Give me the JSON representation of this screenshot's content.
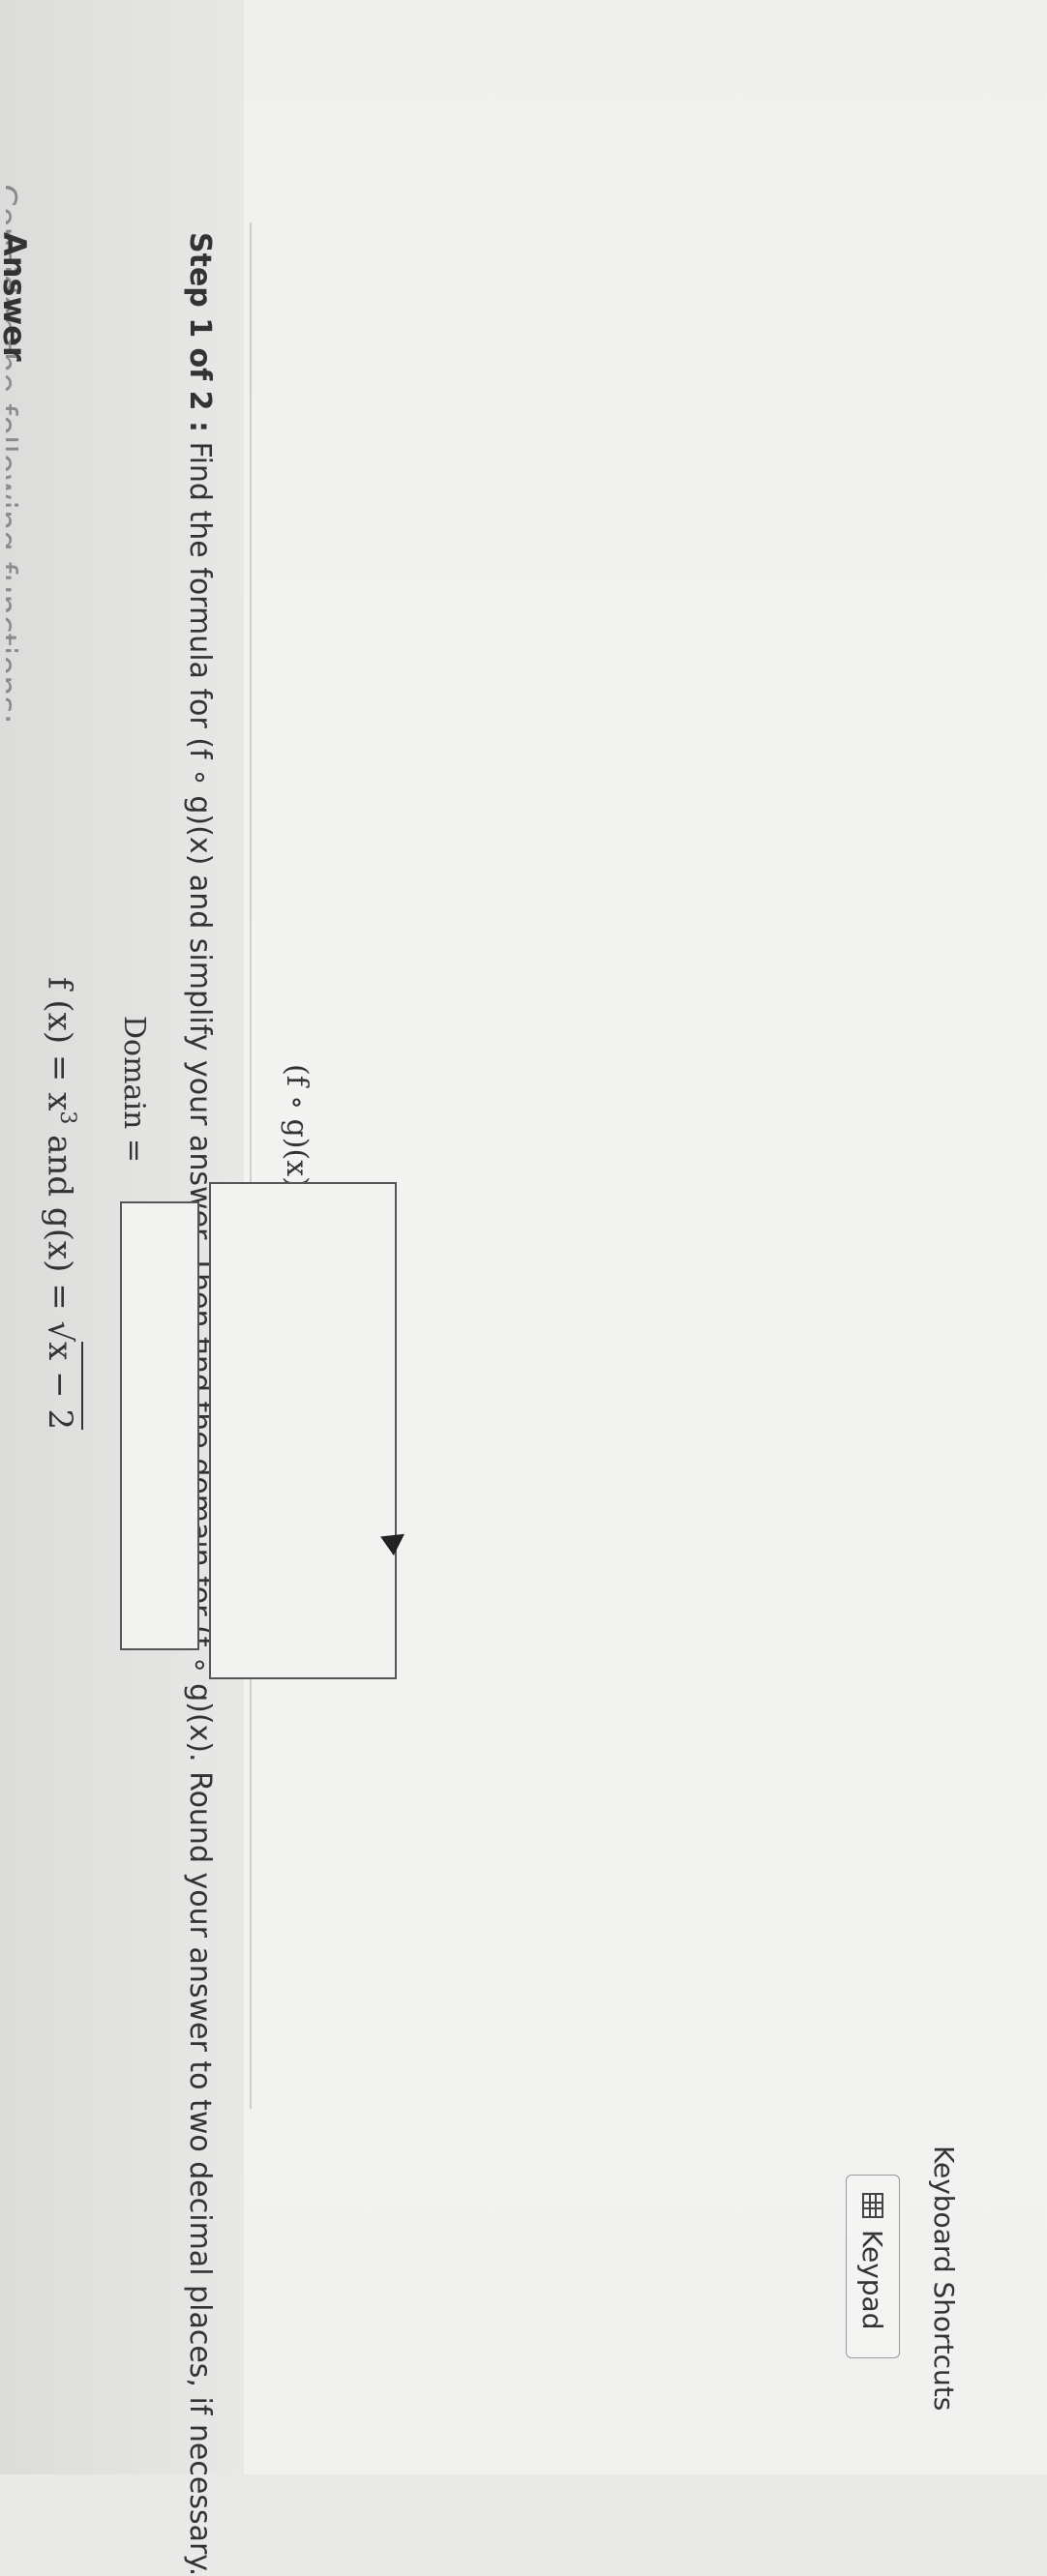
{
  "header": {
    "cut_text": "Consider the following functions:"
  },
  "problem": {
    "formula_f": "f (x) = x",
    "formula_exp": "3",
    "formula_mid": " and g(x) = ",
    "formula_sqrt": "√",
    "formula_radicand": "x − 2",
    "step_label": "Step 1 of 2 :",
    "step_text": " Find the formula for (f ∘ g)(x) and simplify your answer. Then find the domain for (f ∘ g)(x). Round your answer to two decimal places, if necessary."
  },
  "answer": {
    "label": "Answer",
    "composition_label": "(f ∘ g)(x) =",
    "composition_value": "",
    "domain_label": "Domain =",
    "domain_value": ""
  },
  "tools": {
    "keypad_label": "Keypad",
    "shortcuts_label": "Keyboard Shortcuts"
  }
}
